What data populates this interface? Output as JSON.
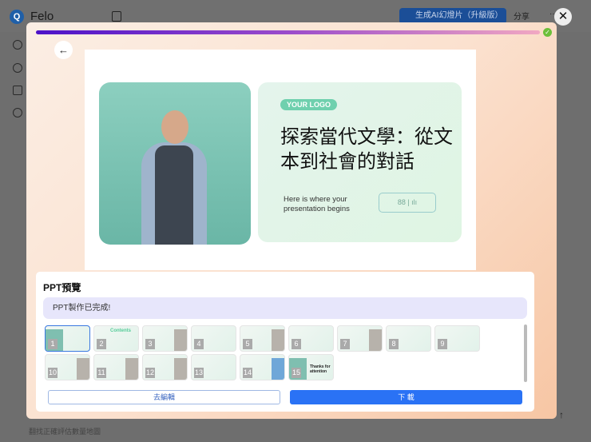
{
  "app": {
    "name": "Felo",
    "generate_button": "生成AI幻燈片（升級版）",
    "share_label": "分享",
    "more_label": "···",
    "close_label": "✕"
  },
  "modal": {
    "progress_percent": 100,
    "back_icon": "←"
  },
  "slide": {
    "logo_text": "YOUR LOGO",
    "title": "探索當代文學：從文本到社會的對話",
    "subtitle_line1": "Here is where your",
    "subtitle_line2": "presentation begins",
    "icons": "88 | ılı"
  },
  "preview": {
    "title": "PPT預覽",
    "status": "PPT製作已完成!",
    "thumbnails": [
      "1",
      "2",
      "3",
      "4",
      "5",
      "6",
      "7",
      "8",
      "9",
      "10",
      "11",
      "12",
      "13",
      "14",
      "15"
    ],
    "thumb2_label": "Contents",
    "thumb15_label": "Thanks for attention",
    "edit_button": "去編輯",
    "download_button": "下 載"
  },
  "background": {
    "bottom_text": "翻找正確評估數量地圖",
    "scroll_top_icon": "↑"
  }
}
